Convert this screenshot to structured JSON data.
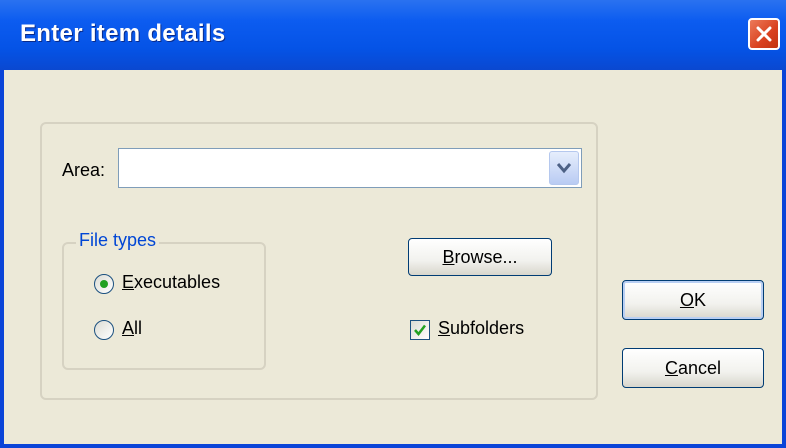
{
  "dialog": {
    "title": "Enter item details"
  },
  "area": {
    "label": "Area:",
    "value": ""
  },
  "file_types": {
    "legend": "File types",
    "options": [
      {
        "mnemonic": "E",
        "rest": "xecutables",
        "selected": true
      },
      {
        "mnemonic": "A",
        "rest": "ll",
        "selected": false
      }
    ]
  },
  "buttons": {
    "browse": {
      "mnemonic": "B",
      "rest": "rowse..."
    },
    "ok": {
      "mnemonic": "O",
      "rest": "K"
    },
    "cancel": {
      "mnemonic": "C",
      "rest": "ancel"
    }
  },
  "subfolders": {
    "mnemonic": "S",
    "rest": "ubfolders",
    "checked": true
  },
  "colors": {
    "title_bar": "#0553e6",
    "dialog_bg": "#ece9d8",
    "legend_text": "#0046d5",
    "radio_dot": "#21a121",
    "checkmark": "#21a121",
    "close_button": "#d9411e"
  }
}
